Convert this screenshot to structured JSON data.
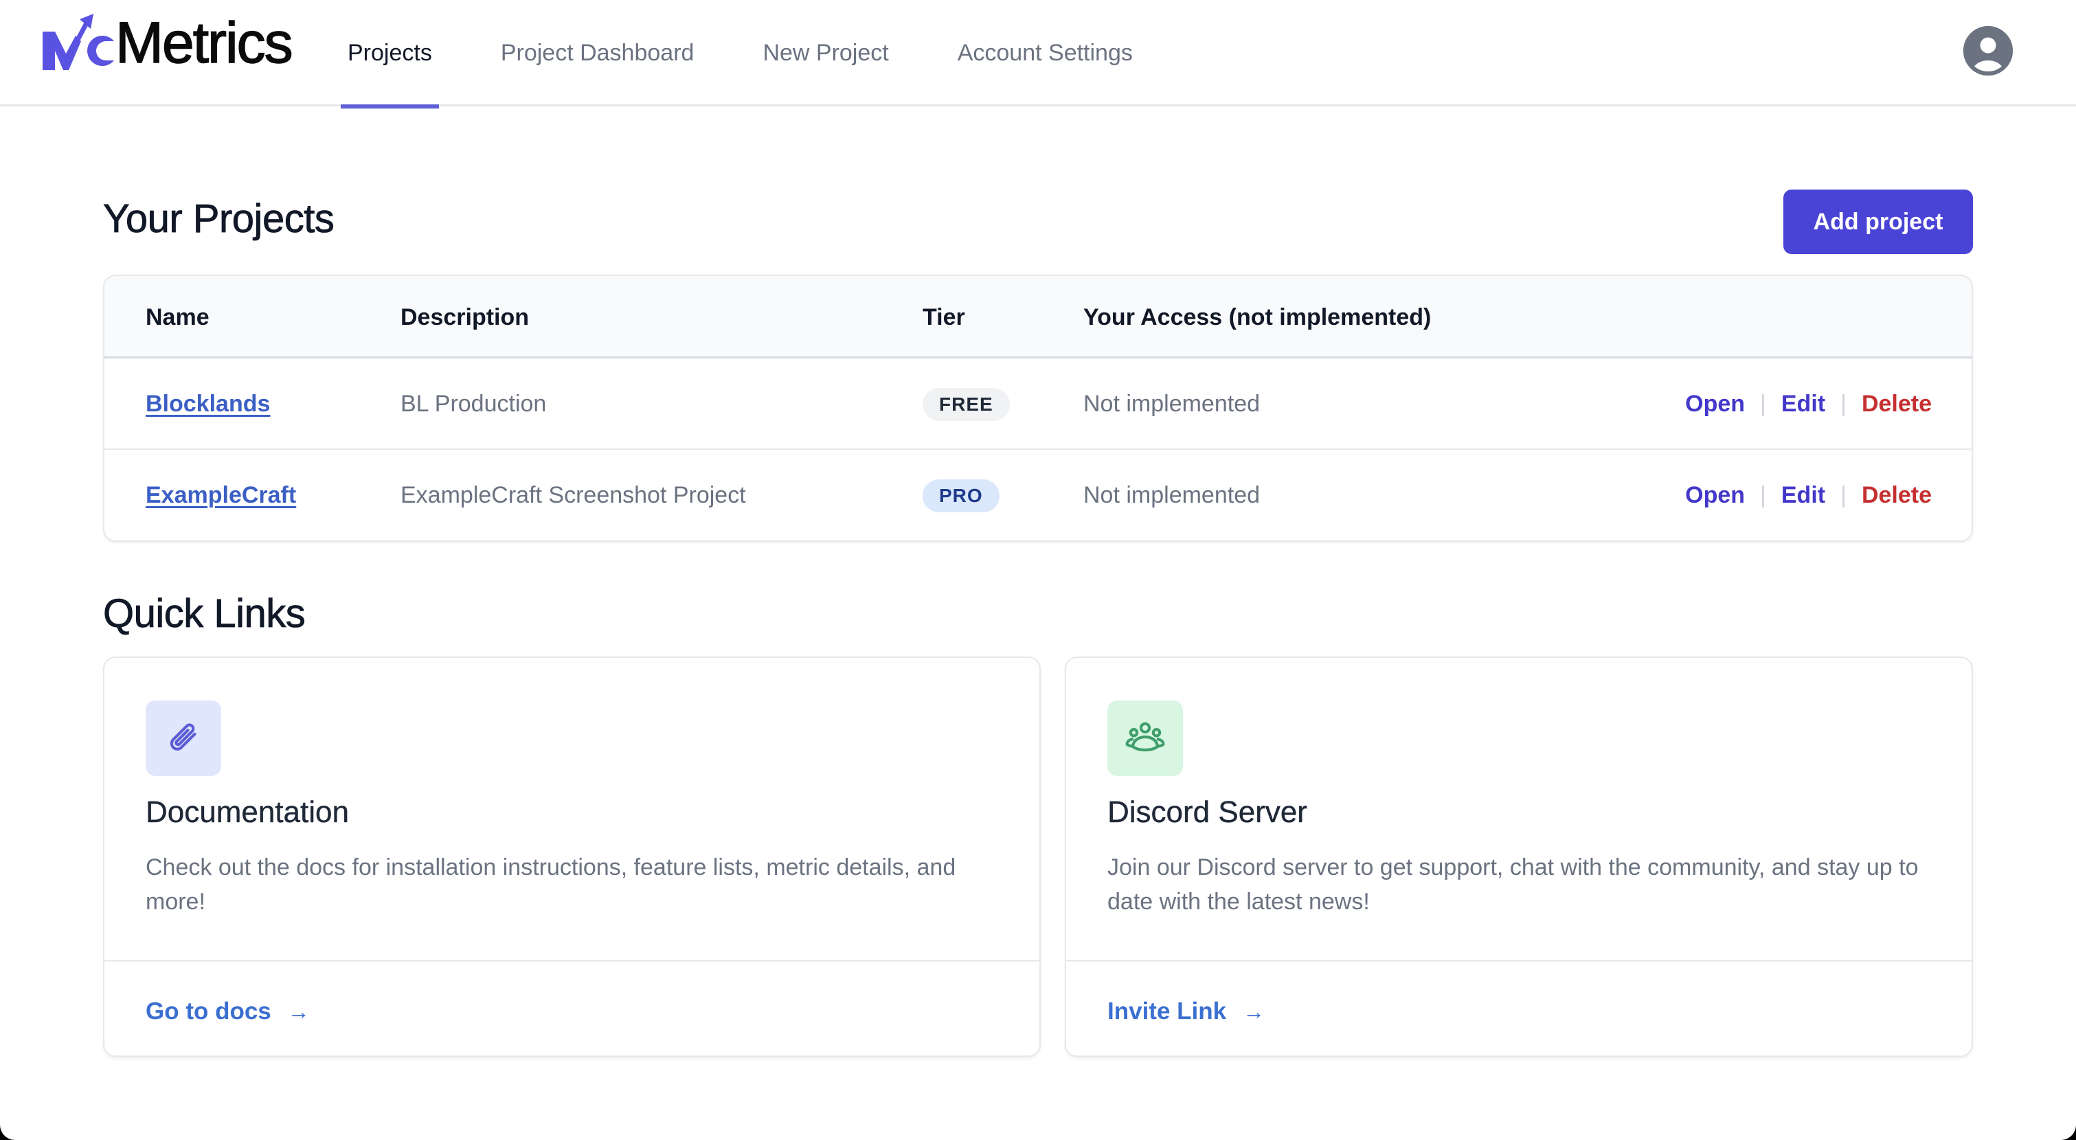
{
  "app": {
    "logo_mark": "MC",
    "logo_text": "Metrics",
    "brand_color": "#5a52e0"
  },
  "nav": {
    "items": [
      {
        "label": "Projects",
        "active": true
      },
      {
        "label": "Project Dashboard",
        "active": false
      },
      {
        "label": "New Project",
        "active": false
      },
      {
        "label": "Account Settings",
        "active": false
      }
    ],
    "avatar_icon": "user-circle-icon"
  },
  "projects": {
    "title": "Your Projects",
    "add_button_label": "Add project",
    "columns": [
      "Name",
      "Description",
      "Tier",
      "Your Access (not implemented)"
    ],
    "rows": [
      {
        "name": "Blocklands",
        "description": "BL Production",
        "tier": "FREE",
        "access": "Not implemented",
        "actions": {
          "open": "Open",
          "edit": "Edit",
          "delete": "Delete"
        }
      },
      {
        "name": "ExampleCraft",
        "description": "ExampleCraft Screenshot Project",
        "tier": "PRO",
        "access": "Not implemented",
        "actions": {
          "open": "Open",
          "edit": "Edit",
          "delete": "Delete"
        }
      }
    ],
    "action_separator": "|"
  },
  "quick_links": {
    "title": "Quick Links",
    "cards": [
      {
        "icon": "paperclip-icon",
        "title": "Documentation",
        "description": "Check out the docs for installation instructions, feature lists, metric details, and more!",
        "link_label": "Go to docs",
        "arrow": "→"
      },
      {
        "icon": "users-group-icon",
        "title": "Discord Server",
        "description": "Join our Discord server to get support, chat with the community, and stay up to date with the latest news!",
        "link_label": "Invite Link",
        "arrow": "→"
      }
    ]
  },
  "colors": {
    "primary_button": "#4a44d6",
    "link_action": "#4338ca",
    "delete_action": "#c53030",
    "project_link": "#3b5fc4",
    "nav_active_underline": "#5f5fd6"
  }
}
